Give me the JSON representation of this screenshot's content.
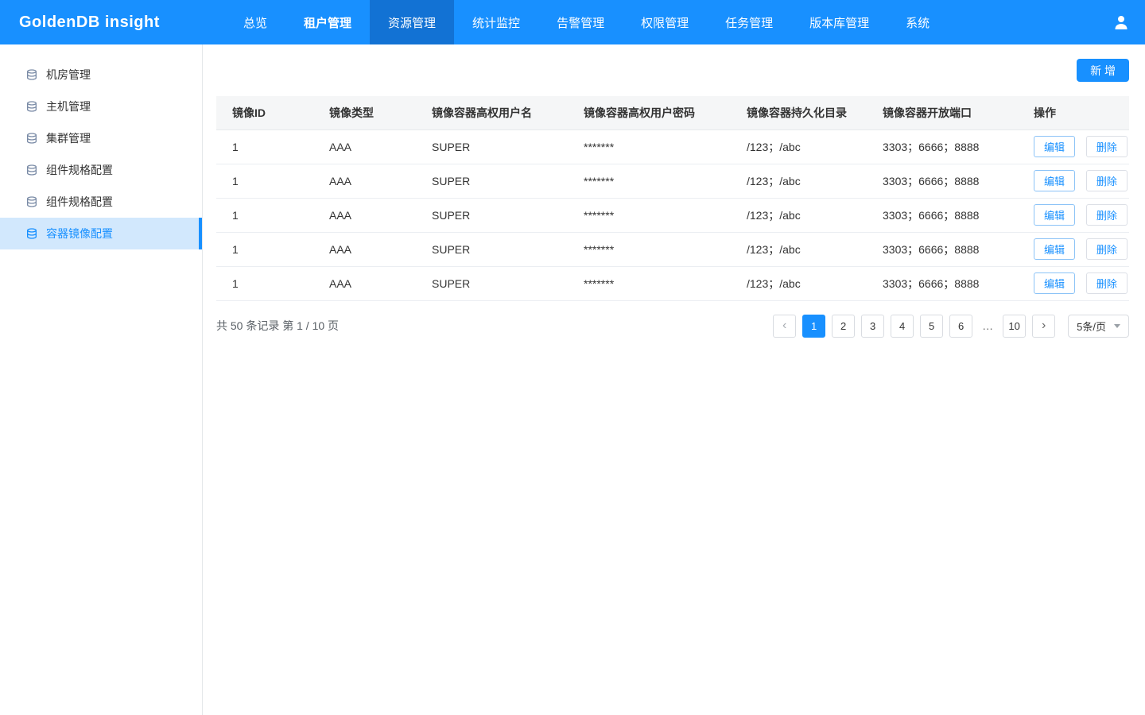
{
  "header": {
    "logo": "GoldenDB insight",
    "nav": [
      "总览",
      "租户管理",
      "资源管理",
      "统计监控",
      "告警管理",
      "权限管理",
      "任务管理",
      "版本库管理",
      "系统"
    ],
    "active_nav": "资源管理"
  },
  "sidebar": {
    "items": [
      "机房管理",
      "主机管理",
      "集群管理",
      "组件规格配置",
      "组件规格配置",
      "容器镜像配置"
    ],
    "active_item": "容器镜像配置"
  },
  "toolbar": {
    "add_label": "新 增"
  },
  "table": {
    "headers": [
      "镜像ID",
      "镜像类型",
      "镜像容器高权用户名",
      "镜像容器高权用户密码",
      "镜像容器持久化目录",
      "镜像容器开放端口",
      "操作"
    ],
    "actions": {
      "edit": "编辑",
      "delete": "删除"
    },
    "rows": [
      {
        "image_id": "1",
        "image_type": "AAA",
        "user": "SUPER",
        "password": "*******",
        "dir": "/123；/abc",
        "ports": "3303；6666；8888"
      },
      {
        "image_id": "1",
        "image_type": "AAA",
        "user": "SUPER",
        "password": "*******",
        "dir": "/123；/abc",
        "ports": "3303；6666；8888"
      },
      {
        "image_id": "1",
        "image_type": "AAA",
        "user": "SUPER",
        "password": "*******",
        "dir": "/123；/abc",
        "ports": "3303；6666；8888"
      },
      {
        "image_id": "1",
        "image_type": "AAA",
        "user": "SUPER",
        "password": "*******",
        "dir": "/123；/abc",
        "ports": "3303；6666；8888"
      },
      {
        "image_id": "1",
        "image_type": "AAA",
        "user": "SUPER",
        "password": "*******",
        "dir": "/123；/abc",
        "ports": "3303；6666；8888"
      }
    ]
  },
  "pagination": {
    "summary": "共 50 条记录 第 1 / 10 页",
    "prev_icon": "‹",
    "next_icon": "›",
    "pages": [
      "1",
      "2",
      "3",
      "4",
      "5",
      "6",
      "…",
      "10"
    ],
    "active_page": "1",
    "page_size": "5条/页"
  },
  "icons": {
    "user": "person-icon",
    "sidebar_item": "database-icon",
    "select_caret": "chevron-down-icon"
  },
  "colors": {
    "primary": "#1890ff",
    "nav_active_bg": "#1272d4",
    "sidebar_active_bg": "#d2e8fd",
    "table_header_bg": "#f5f6f7"
  }
}
